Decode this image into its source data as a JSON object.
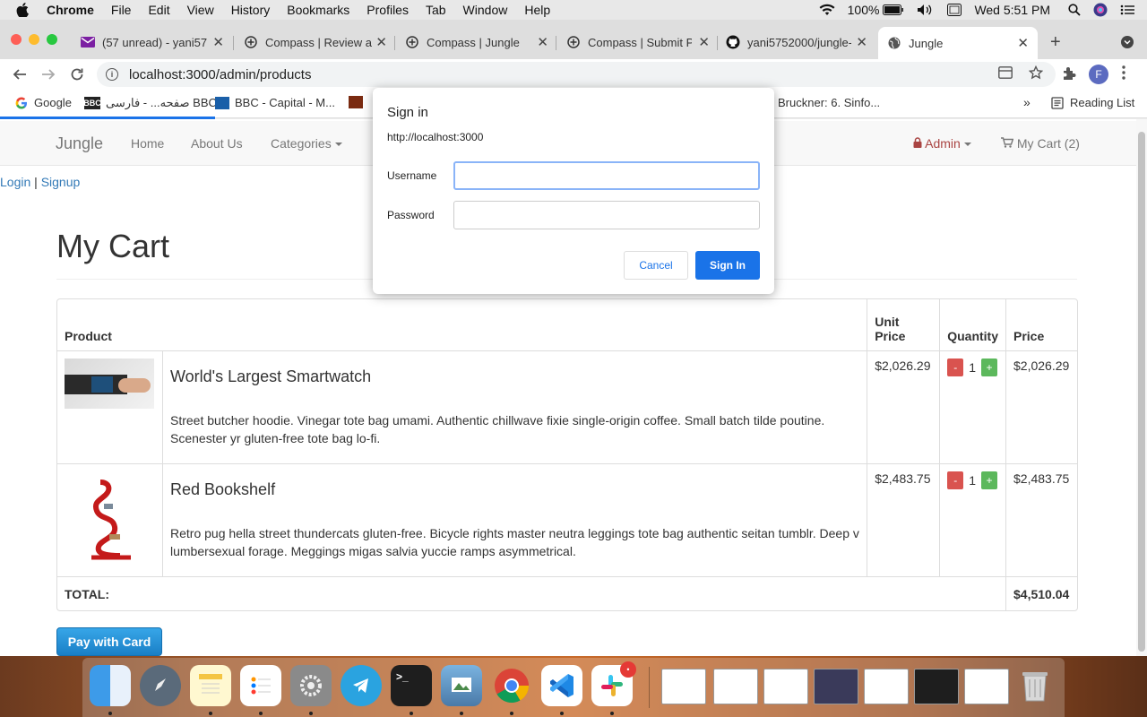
{
  "menubar": {
    "items": [
      "Chrome",
      "File",
      "Edit",
      "View",
      "History",
      "Bookmarks",
      "Profiles",
      "Tab",
      "Window",
      "Help"
    ],
    "battery": "100%",
    "clock": "Wed 5:51 PM"
  },
  "tabs": [
    {
      "title": "(57 unread) - yani57",
      "icon": "mail-icon"
    },
    {
      "title": "Compass | Review a",
      "icon": "compass-icon"
    },
    {
      "title": "Compass | Jungle",
      "icon": "compass-icon"
    },
    {
      "title": "Compass | Submit P",
      "icon": "compass-icon"
    },
    {
      "title": "yani5752000/jungle-",
      "icon": "github-icon"
    },
    {
      "title": "Jungle",
      "icon": "globe-icon"
    }
  ],
  "toolbar": {
    "url": "localhost:3000/admin/products",
    "profile_initial": "F"
  },
  "bookmarks": {
    "items": [
      {
        "label": "Google",
        "icon": "google-icon"
      },
      {
        "label": "صفحه... - فارسی BBC",
        "icon": "bbc-icon"
      },
      {
        "label": "BBC - Capital - M...",
        "icon": "bbc-capital-icon"
      },
      {
        "label": "Bruckner: 6. Sinfo...",
        "icon": "music-icon"
      }
    ],
    "reading_list": "Reading List"
  },
  "navbar": {
    "brand": "Jungle",
    "links": [
      "Home",
      "About Us",
      "Categories"
    ],
    "admin": "Admin",
    "cart": "My Cart (2)"
  },
  "auth": {
    "login": "Login",
    "separator": "|",
    "signup": "Signup"
  },
  "page_title": "My Cart",
  "cart": {
    "headers": {
      "product": "Product",
      "unit_price": "Unit Price",
      "quantity": "Quantity",
      "price": "Price"
    },
    "items": [
      {
        "name": "World's Largest Smartwatch",
        "description": "Street butcher hoodie. Vinegar tote bag umami. Authentic chillwave fixie single-origin coffee. Small batch tilde poutine. Scenester yr gluten-free tote bag lo-fi.",
        "unit_price": "$2,026.29",
        "quantity": "1",
        "price": "$2,026.29"
      },
      {
        "name": "Red Bookshelf",
        "description": "Retro pug hella street thundercats gluten-free. Bicycle rights master neutra leggings tote bag authentic seitan tumblr. Deep v lumbersexual forage. Meggings migas salvia yuccie ramps asymmetrical.",
        "unit_price": "$2,483.75",
        "quantity": "1",
        "price": "$2,483.75"
      }
    ],
    "minus": "-",
    "plus": "+",
    "total_label": "TOTAL:",
    "total_value": "$4,510.04"
  },
  "pay_button": "Pay with Card",
  "dialog": {
    "title": "Sign in",
    "url": "http://localhost:3000",
    "username_label": "Username",
    "password_label": "Password",
    "username_value": "",
    "password_value": "",
    "cancel": "Cancel",
    "sign_in": "Sign In"
  },
  "dock": {
    "apps": [
      "finder-icon",
      "launchpad-icon",
      "notes-icon",
      "reminders-icon",
      "system-preferences-icon",
      "telegram-icon",
      "terminal-icon",
      "preview-icon",
      "chrome-icon",
      "vscode-icon",
      "slack-icon"
    ],
    "slack_badge": "•"
  },
  "colors": {
    "link": "#337ab7",
    "admin": "#a94442",
    "danger": "#d9534f",
    "success": "#5cb85c",
    "primary": "#1a73e8"
  }
}
